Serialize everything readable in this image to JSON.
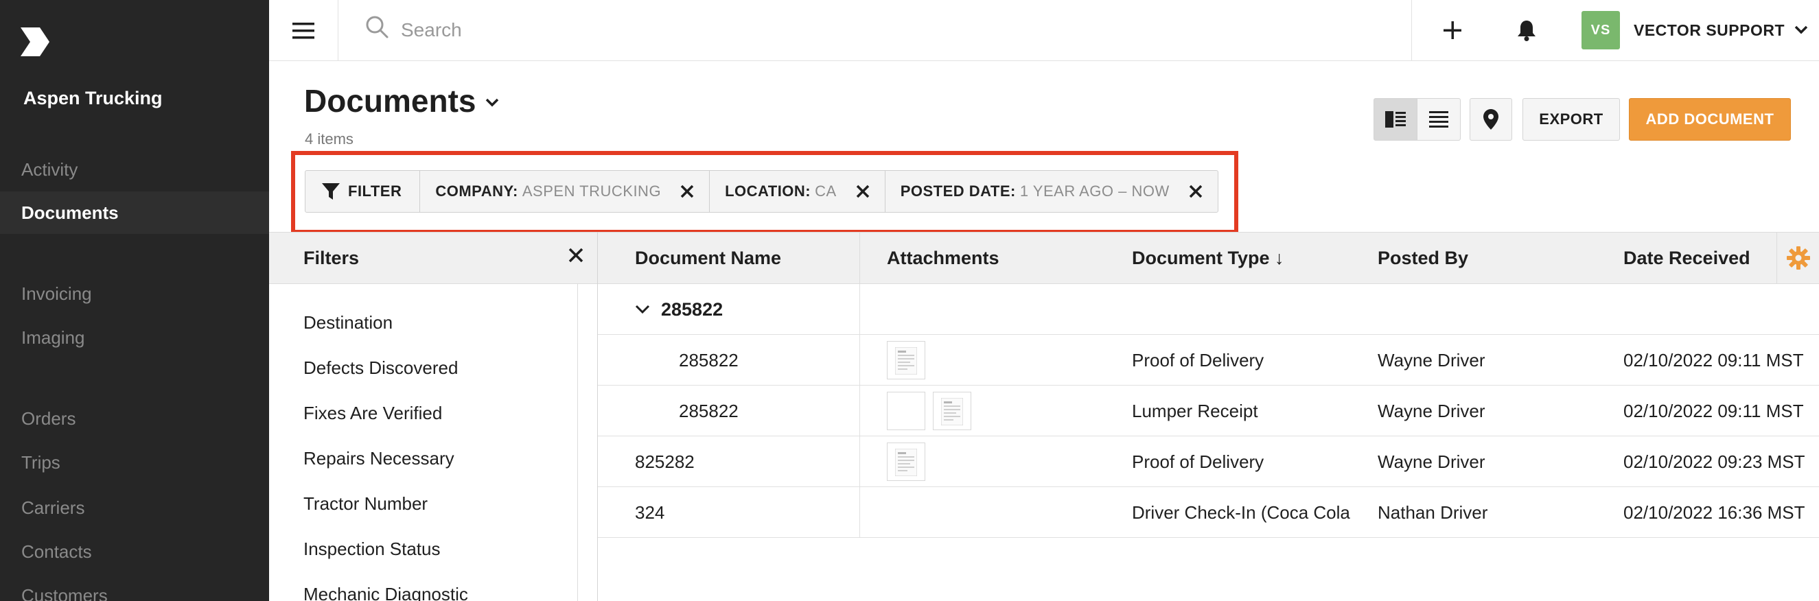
{
  "app": {
    "company_name": "Aspen Trucking",
    "logo_icon": "vector-logo-icon"
  },
  "sidebar": {
    "items": [
      {
        "label": "Activity",
        "active": false
      },
      {
        "label": "Documents",
        "active": true
      },
      {
        "label": "Invoicing",
        "active": false
      },
      {
        "label": "Imaging",
        "active": false
      },
      {
        "label": "Orders",
        "active": false
      },
      {
        "label": "Trips",
        "active": false
      },
      {
        "label": "Carriers",
        "active": false
      },
      {
        "label": "Contacts",
        "active": false
      },
      {
        "label": "Customers",
        "active": false
      }
    ]
  },
  "topbar": {
    "search_placeholder": "Search",
    "avatar_initials": "VS",
    "user_name": "VECTOR SUPPORT",
    "avatar_color": "#7ab86d"
  },
  "page": {
    "title": "Documents",
    "item_count": "4 items"
  },
  "toolbar": {
    "export_label": "EXPORT",
    "add_label": "ADD DOCUMENT",
    "accent_color": "#ef9a3b"
  },
  "filter_bar": {
    "filter_label": "FILTER",
    "chips": [
      {
        "key": "COMPANY:",
        "value": "ASPEN TRUCKING"
      },
      {
        "key": "LOCATION:",
        "value": "CA"
      },
      {
        "key": "POSTED DATE:",
        "value": "1 YEAR AGO – NOW"
      }
    ],
    "highlight_color": "#e33b22"
  },
  "filters_panel": {
    "title": "Filters",
    "items": [
      "Destination",
      "Defects Discovered",
      "Fixes Are Verified",
      "Repairs Necessary",
      "Tractor Number",
      "Inspection Status",
      "Mechanic Diagnostic"
    ]
  },
  "table": {
    "columns": [
      "Document Name",
      "Attachments",
      "Document Type ↓",
      "Posted By",
      "Date Received"
    ],
    "group": {
      "label": "285822"
    },
    "rows": [
      {
        "name": "285822",
        "attachments": 1,
        "type": "Proof of Delivery",
        "posted_by": "Wayne Driver",
        "date": "02/10/2022 09:11 MST"
      },
      {
        "name": "285822",
        "attachments": 2,
        "type": "Lumper Receipt",
        "posted_by": "Wayne Driver",
        "date": "02/10/2022 09:11 MST"
      },
      {
        "name": "825282",
        "attachments": 1,
        "type": "Proof of Delivery",
        "posted_by": "Wayne Driver",
        "date": "02/10/2022 09:23 MST"
      },
      {
        "name": "324",
        "attachments": 0,
        "type": "Driver Check-In (Coca Cola",
        "posted_by": "Nathan Driver",
        "date": "02/10/2022 16:36 MST"
      }
    ]
  }
}
